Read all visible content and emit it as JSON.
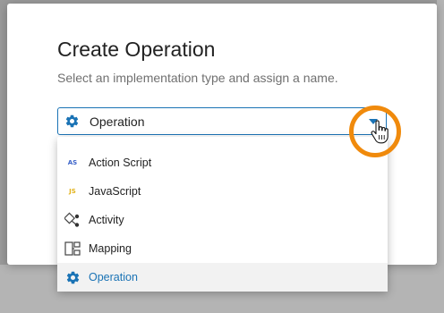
{
  "dialog": {
    "title": "Create Operation",
    "subtitle": "Select an implementation type and assign a name."
  },
  "type_select": {
    "selected_value": "Operation",
    "options": [
      {
        "label": "Action Script",
        "icon": "action-script-icon",
        "badge": "AS",
        "color": "#3b63c9"
      },
      {
        "label": "JavaScript",
        "icon": "javascript-icon",
        "badge": "JS",
        "color": "#e2b21a"
      },
      {
        "label": "Activity",
        "icon": "activity-icon"
      },
      {
        "label": "Mapping",
        "icon": "mapping-icon"
      },
      {
        "label": "Operation",
        "icon": "gear-icon",
        "selected": true
      }
    ]
  },
  "colors": {
    "accent": "#1a73b5",
    "highlight_ring": "#f08a0c"
  }
}
